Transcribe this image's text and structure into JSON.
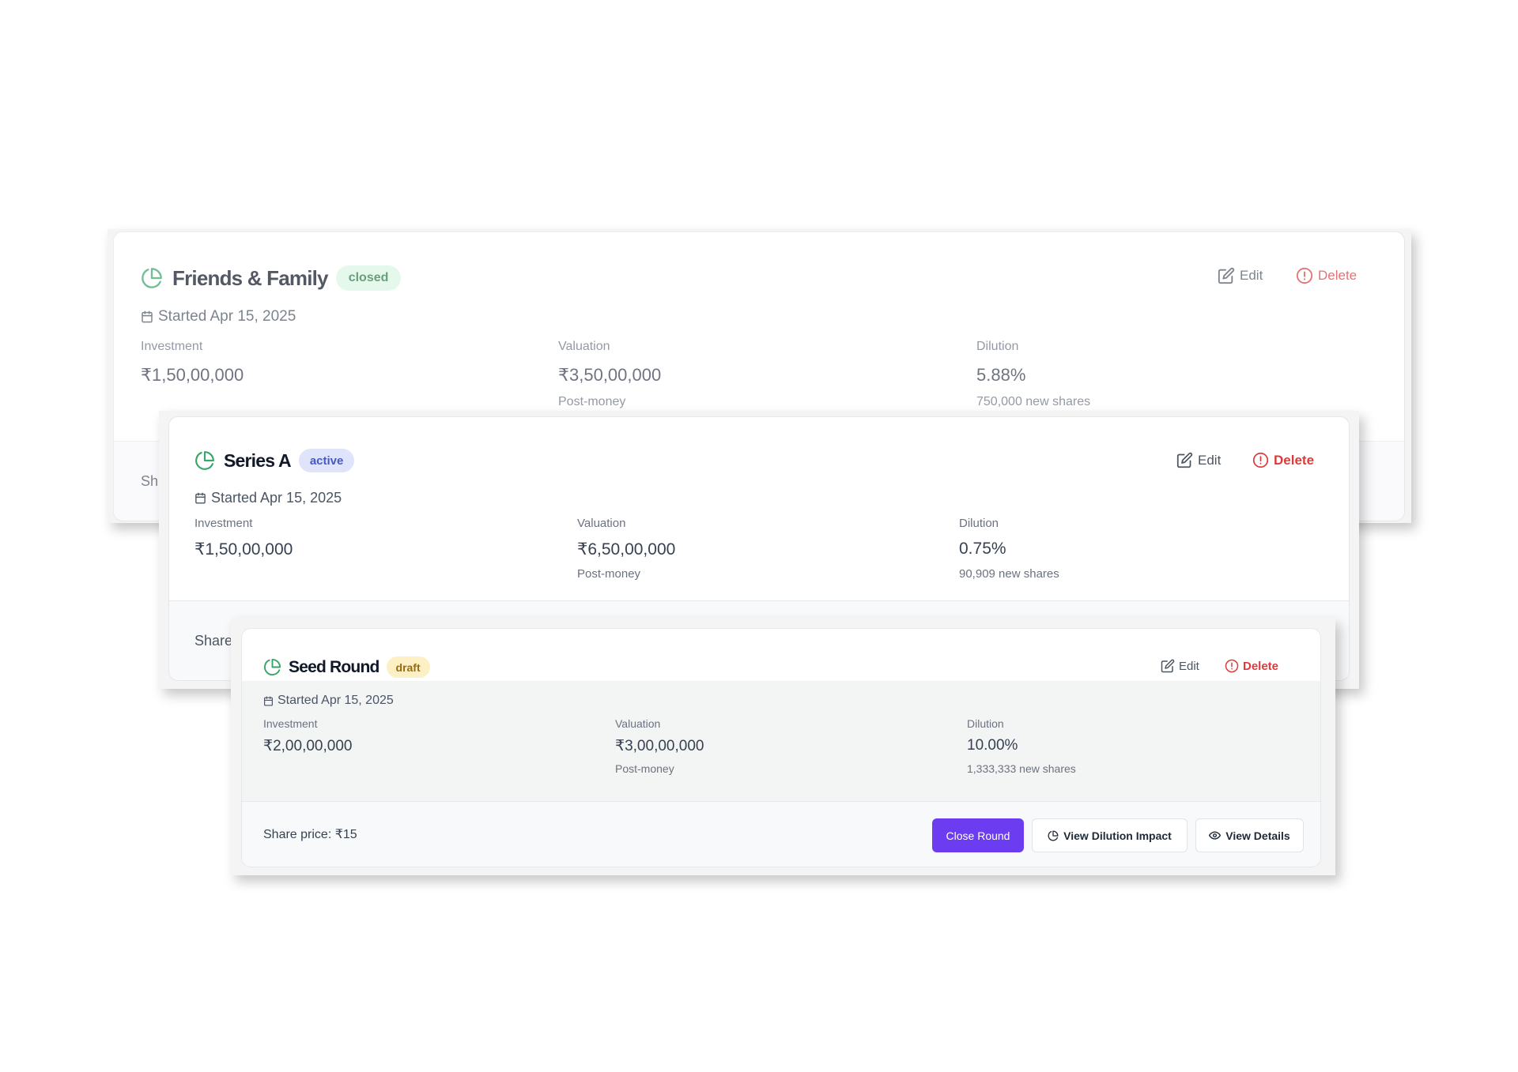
{
  "rounds": [
    {
      "name": "Friends & Family",
      "status": "closed",
      "started": "Started Apr 15, 2025",
      "investment": {
        "label": "Investment",
        "value": "₹1,50,00,000"
      },
      "valuation": {
        "label": "Valuation",
        "value": "₹3,50,00,000",
        "note": "Post-money"
      },
      "dilution": {
        "label": "Dilution",
        "value": "5.88%",
        "note": "750,000 new shares"
      },
      "footer_partial": "Sh",
      "edit_label": "Edit",
      "delete_label": "Delete"
    },
    {
      "name": "Series A",
      "status": "active",
      "started": "Started Apr 15, 2025",
      "investment": {
        "label": "Investment",
        "value": "₹1,50,00,000"
      },
      "valuation": {
        "label": "Valuation",
        "value": "₹6,50,00,000",
        "note": "Post-money"
      },
      "dilution": {
        "label": "Dilution",
        "value": "0.75%",
        "note": "90,909 new shares"
      },
      "footer_partial": "Share",
      "edit_label": "Edit",
      "delete_label": "Delete"
    },
    {
      "name": "Seed Round",
      "status": "draft",
      "started": "Started Apr 15, 2025",
      "investment": {
        "label": "Investment",
        "value": "₹2,00,00,000"
      },
      "valuation": {
        "label": "Valuation",
        "value": "₹3,00,00,000",
        "note": "Post-money"
      },
      "dilution": {
        "label": "Dilution",
        "value": "10.00%",
        "note": "1,333,333 new shares"
      },
      "share_price": "Share price: ₹15",
      "edit_label": "Edit",
      "delete_label": "Delete",
      "buttons": {
        "close_round": "Close Round",
        "view_dilution": "View Dilution Impact",
        "view_details": "View Details"
      }
    }
  ],
  "colors": {
    "accent": "#6b3cf0",
    "pie_icon": "#3aa569",
    "delete": "#dc3b3b",
    "badge_closed": "#dcf5e5",
    "badge_active": "#dfe4fb",
    "badge_draft": "#fdf0c4"
  },
  "icons": [
    "pie-chart-icon",
    "calendar-icon",
    "edit-icon",
    "alert-circle-icon",
    "eye-icon"
  ]
}
